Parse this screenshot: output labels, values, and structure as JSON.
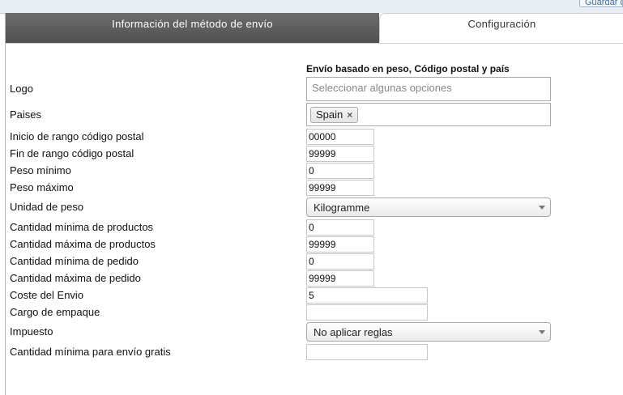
{
  "top_link": "Guardar c",
  "tabs": {
    "active": "Información del método de envío",
    "inactive": "Configuración"
  },
  "section_title": "Envío basado en peso, Código postal y país",
  "fields": {
    "logo": {
      "label": "Logo",
      "placeholder": "Seleccionar algunas opciones"
    },
    "paises": {
      "label": "Paises",
      "tag": "Spain",
      "tag_remove": "×"
    },
    "postal_start": {
      "label": "Inicio de rango código postal",
      "value": "00000"
    },
    "postal_end": {
      "label": "Fin de rango código postal",
      "value": "99999"
    },
    "weight_min": {
      "label": "Peso mínimo",
      "value": "0"
    },
    "weight_max": {
      "label": "Peso máximo",
      "value": "99999"
    },
    "weight_unit": {
      "label": "Unidad de peso",
      "value": "Kilogramme"
    },
    "qty_min": {
      "label": "Cantidad mínima de productos",
      "value": "0"
    },
    "qty_max": {
      "label": "Cantidad máxima de productos",
      "value": "99999"
    },
    "order_min": {
      "label": "Cantidad mínima de pedido",
      "value": "0"
    },
    "order_max": {
      "label": "Cantidad máxima de pedido",
      "value": "99999"
    },
    "shipping_cost": {
      "label": "Coste del Envio",
      "value": "5"
    },
    "packing_charge": {
      "label": "Cargo de empaque",
      "value": ""
    },
    "tax": {
      "label": "Impuesto",
      "value": "No aplicar reglas"
    },
    "free_min": {
      "label": "Cantidad mínima para envío gratis",
      "value": ""
    }
  }
}
